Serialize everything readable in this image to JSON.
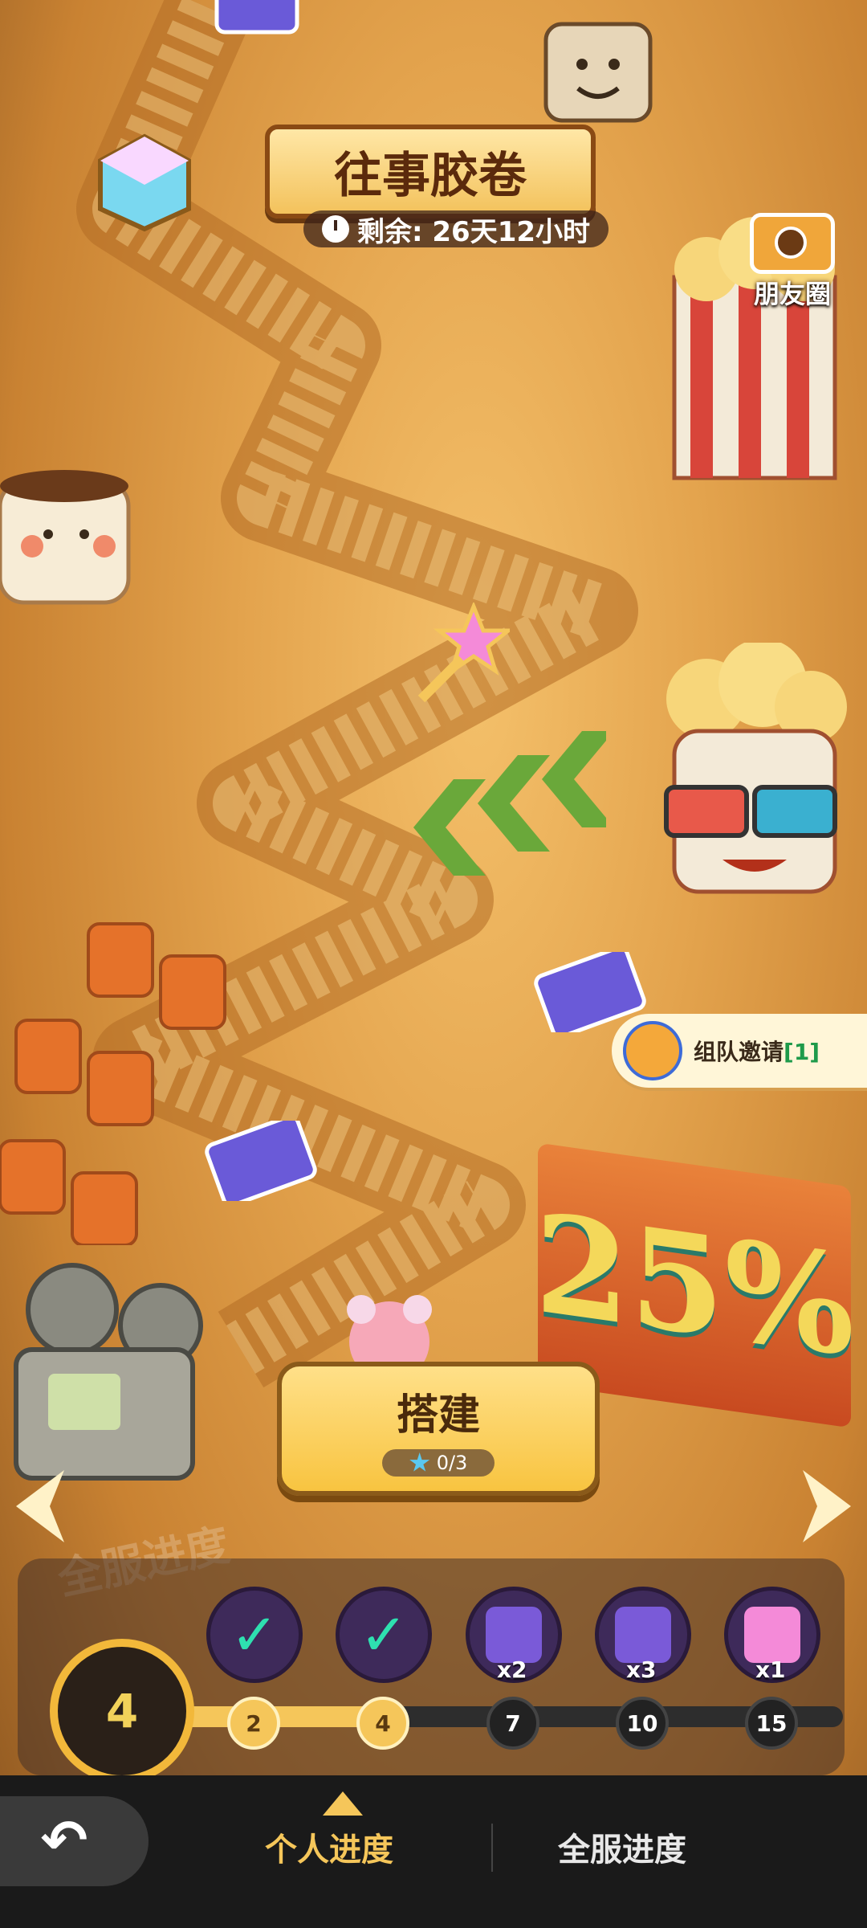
{
  "event": {
    "title": "往事胶卷",
    "timer_text": "剩余: 26天12小时"
  },
  "side": {
    "moments_label": "朋友圈",
    "team_invite_label": "组队邀请",
    "team_invite_count": "[1]"
  },
  "scene": {
    "billboard_text": "25%",
    "floor_text": "全服进度"
  },
  "build": {
    "label": "搭建",
    "progress": "0/3"
  },
  "progress": {
    "level": "4",
    "milestones": [
      {
        "node": "2",
        "done": true,
        "reward": "check",
        "mult": ""
      },
      {
        "node": "4",
        "done": true,
        "reward": "check",
        "mult": ""
      },
      {
        "node": "7",
        "done": false,
        "reward": "ticket",
        "mult": "x2"
      },
      {
        "node": "10",
        "done": false,
        "reward": "ticket",
        "mult": "x3"
      },
      {
        "node": "15",
        "done": false,
        "reward": "key",
        "mult": "x1"
      }
    ]
  },
  "nav": {
    "tab_personal": "个人进度",
    "tab_server": "全服进度"
  },
  "colors": {
    "accent": "#f5c65a",
    "check": "#2ee0b0",
    "team_count": "#1e9a4a"
  }
}
